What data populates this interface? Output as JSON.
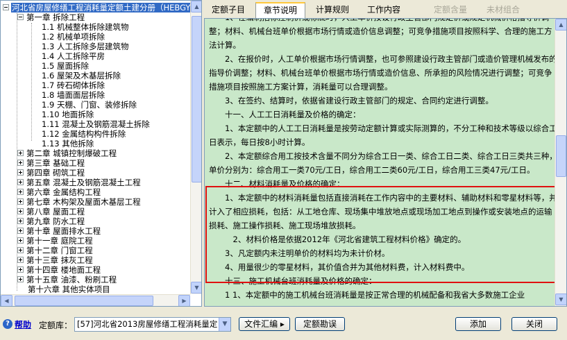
{
  "tree": {
    "root_label": "河北省房屋修缮工程消耗量定额土建分册（HEBGY",
    "items": [
      {
        "label": "第一章 拆除工程",
        "expanded": true
      },
      {
        "label": "1.1 机械整体拆除建筑物"
      },
      {
        "label": "1.2 机械单项拆除"
      },
      {
        "label": "1.3 人工拆除多层建筑物"
      },
      {
        "label": "1.4 人工拆除平房"
      },
      {
        "label": "1.5 屋面拆除"
      },
      {
        "label": "1.6 屋架及木基层拆除"
      },
      {
        "label": "1.7 砖石砌体拆除"
      },
      {
        "label": "1.8 墙面面层拆除"
      },
      {
        "label": "1.9 天棚、门窗、装修拆除"
      },
      {
        "label": "1.10 地面拆除"
      },
      {
        "label": "1.11 混凝土及钢筋混凝土拆除"
      },
      {
        "label": "1.12 金属结构构件拆除"
      },
      {
        "label": "1.13 其他拆除"
      },
      {
        "label": "第二章 城镇控制爆破工程"
      },
      {
        "label": "第三章 基础工程"
      },
      {
        "label": "第四章 砌筑工程"
      },
      {
        "label": "第五章 混凝土及钢筋混凝土工程"
      },
      {
        "label": "第六章 金属结构工程"
      },
      {
        "label": "第七章 木构架及屋面木基层工程"
      },
      {
        "label": "第八章 屋面工程"
      },
      {
        "label": "第九章 防水工程"
      },
      {
        "label": "第十章 屋面排水工程"
      },
      {
        "label": "第十一章 庭院工程"
      },
      {
        "label": "第十二章 门窗工程"
      },
      {
        "label": "第十三章 抹灰工程"
      },
      {
        "label": "第十四章 楼地面工程"
      },
      {
        "label": "第十五章 油漆、粉刷工程"
      },
      {
        "label": "第十六章 其他实体项目"
      }
    ]
  },
  "tabs": [
    {
      "label": "定额子目",
      "state": "normal"
    },
    {
      "label": "章节说明",
      "state": "active"
    },
    {
      "label": "计算规则",
      "state": "normal"
    },
    {
      "label": "工作内容",
      "state": "normal"
    },
    {
      "label": "定额含量",
      "state": "disabled"
    },
    {
      "label": "未材组合",
      "state": "disabled"
    }
  ],
  "content": {
    "paragraphs": [
      "1、在编制招标控制价或标底时，人工单价按设行政主管部门规定价或规定机械价格指导价调整；材料、机械台班单价根据市场行情或造价信息调整；可竞争措施项目按照科学、合理的施工方法计算。",
      "2、在报价时，人工单价根据市场行情调整，也可参照建设行政主管部门或造价管理机械发布的指导价调整；材料、机械台班单价根据市场行情或造价信息、所承担的风险情况进行调整；可竞争措施项目按照施工方案计算，消耗量可以合理调整。",
      "3、在签约、结算时，依据省建设行政主管部门的规定、合同约定进行调整。",
      "十一、人工工日消耗量及价格的确定：",
      "1、本定额中的人工工日消耗量是按劳动定额计算或实际测算的，不分工种和技术等级以综合工日表示，每日按8小时计算。",
      "2、本定额综合用工按技术含量不同分为综合工日一类、综合工日二类、综合工日三类共三种，单价分别为：综合用工一类70元/工日，综合用工二类60元/工日，综合用工三类47元/工日。",
      "十二、材料消耗量及价格的确定：",
      "1、本定额中的材料消耗量包括直接消耗在工作内容中的主要材料、辅助材料和零星材料等，并计入了相应损耗，包括：从工地仓库、现场集中堆放地点或现场加工地点到操作或安装地点的运输损耗、施工操作损耗、施工现场堆放损耗。",
      "2、材料价格是依据2012年《河北省建筑工程材料价格》确定的。",
      "3、凡定额内未注明单价的材料均为未计价材。",
      "4、用量很少的零星材料，其价值合并为其他材料费，计入材料费中。",
      "十三、施工机械台班消耗量及价格的确定：",
      "1 1、本定额中的施工机械台班消耗量是按正常合理的机械配备和我省大多数施工企业"
    ]
  },
  "bottom": {
    "help_label": "帮助",
    "lib_label": "定额库：",
    "lib_value": "[57]河北省2013房屋修缮工程消耗量定",
    "file_button": "文件汇编 ▸",
    "errata_button": "定额勘误",
    "add_button": "添加",
    "close_button": "关闭"
  },
  "colors": {
    "content_bg": "#c9e8c9",
    "highlight_border": "#e01010",
    "selection": "#316ac5"
  }
}
